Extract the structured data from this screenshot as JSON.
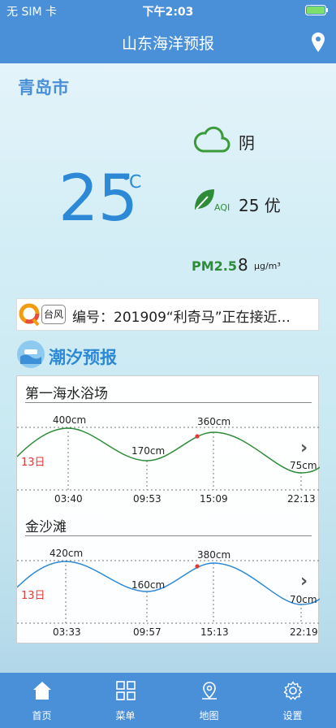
{
  "status": {
    "carrier": "无 SIM 卡",
    "time": "下午2:03"
  },
  "header": {
    "title": "山东海洋预报",
    "location_icon": "location-pin-icon"
  },
  "weather": {
    "city": "青岛市",
    "temperature": "25",
    "temp_unit": "℃",
    "condition": "阴",
    "aqi_label": "AQI",
    "aqi_value": "25 优",
    "pm_label": "PM2.5",
    "pm_value": "8",
    "pm_unit": "μg/m³"
  },
  "news": {
    "tag": "台风",
    "text": "编号：201909“利奇马”正在接近..."
  },
  "tide": {
    "section_title": "潮汐预报",
    "stations": [
      {
        "name": "第一海水浴场",
        "day": "13日",
        "peak1": "400cm",
        "low1": "170cm",
        "peak2": "360cm",
        "low2": "75cm",
        "times": [
          "03:40",
          "09:53",
          "15:09",
          "22:13"
        ]
      },
      {
        "name": "金沙滩",
        "day": "13日",
        "peak1": "420cm",
        "low1": "160cm",
        "peak2": "380cm",
        "low2": "70cm",
        "times": [
          "03:33",
          "09:57",
          "15:13",
          "22:19"
        ]
      }
    ]
  },
  "tabs": [
    {
      "label": "首页",
      "icon": "home-icon"
    },
    {
      "label": "菜单",
      "icon": "grid-menu-icon"
    },
    {
      "label": "地图",
      "icon": "map-pin-icon"
    },
    {
      "label": "设置",
      "icon": "gear-icon"
    }
  ],
  "colors": {
    "primary": "#4a90d9",
    "temp": "#2d89d6",
    "green": "#2e8b3a",
    "curve1": "#2e8b3a",
    "curve2": "#2d89d6",
    "day": "#e53935"
  }
}
